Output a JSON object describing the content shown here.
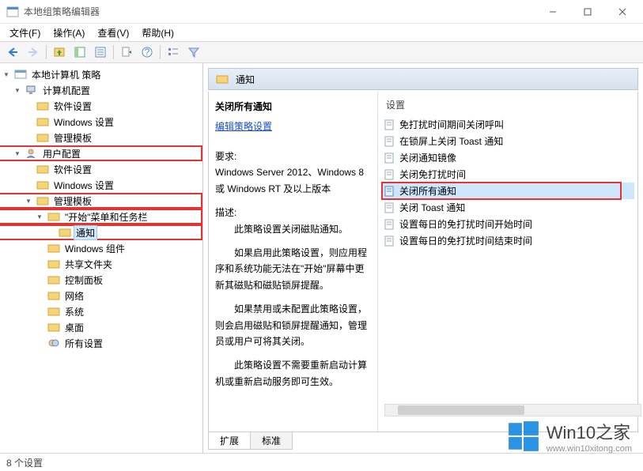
{
  "window": {
    "title": "本地组策略编辑器"
  },
  "menu": {
    "file": "文件(F)",
    "action": "操作(A)",
    "view": "查看(V)",
    "help": "帮助(H)"
  },
  "tree": {
    "root": "本地计算机 策略",
    "cc": "计算机配置",
    "cc_soft": "软件设置",
    "cc_win": "Windows 设置",
    "cc_tpl": "管理模板",
    "uc": "用户配置",
    "uc_soft": "软件设置",
    "uc_win": "Windows 设置",
    "uc_tpl": "管理模板",
    "start": "\"开始\"菜单和任务栏",
    "notify": "通知",
    "wincomp": "Windows 组件",
    "shared": "共享文件夹",
    "cpanel": "控制面板",
    "network": "网络",
    "system": "系统",
    "desktop": "桌面",
    "allset": "所有设置"
  },
  "panel": {
    "header": "通知",
    "title": "关闭所有通知",
    "edit_link": "编辑策略设置",
    "req_label": "要求:",
    "req_text": "Windows Server 2012、Windows 8 或 Windows RT 及以上版本",
    "desc_label": "描述:",
    "p1": "此策略设置关闭磁贴通知。",
    "p2": "如果启用此策略设置，则应用程序和系统功能无法在\"开始\"屏幕中更新其磁贴和磁贴锁屏提醒。",
    "p3": "如果禁用或未配置此策略设置，则会启用磁贴和锁屏提醒通知，管理员或用户可将其关闭。",
    "p4": "此策略设置不需要重新启动计算机或重新启动服务即可生效。"
  },
  "list": {
    "col": "设置",
    "i0": "免打扰时间期间关闭呼叫",
    "i1": "在锁屏上关闭 Toast 通知",
    "i2": "关闭通知镜像",
    "i3": "关闭免打扰时间",
    "i4": "关闭所有通知",
    "i5": "关闭 Toast 通知",
    "i6": "设置每日的免打扰时间开始时间",
    "i7": "设置每日的免打扰时间结束时间"
  },
  "tabs": {
    "ext": "扩展",
    "std": "标准"
  },
  "status": "8 个设置",
  "watermark": {
    "brand": "Win10之家",
    "url": "www.win10xitong.com"
  }
}
